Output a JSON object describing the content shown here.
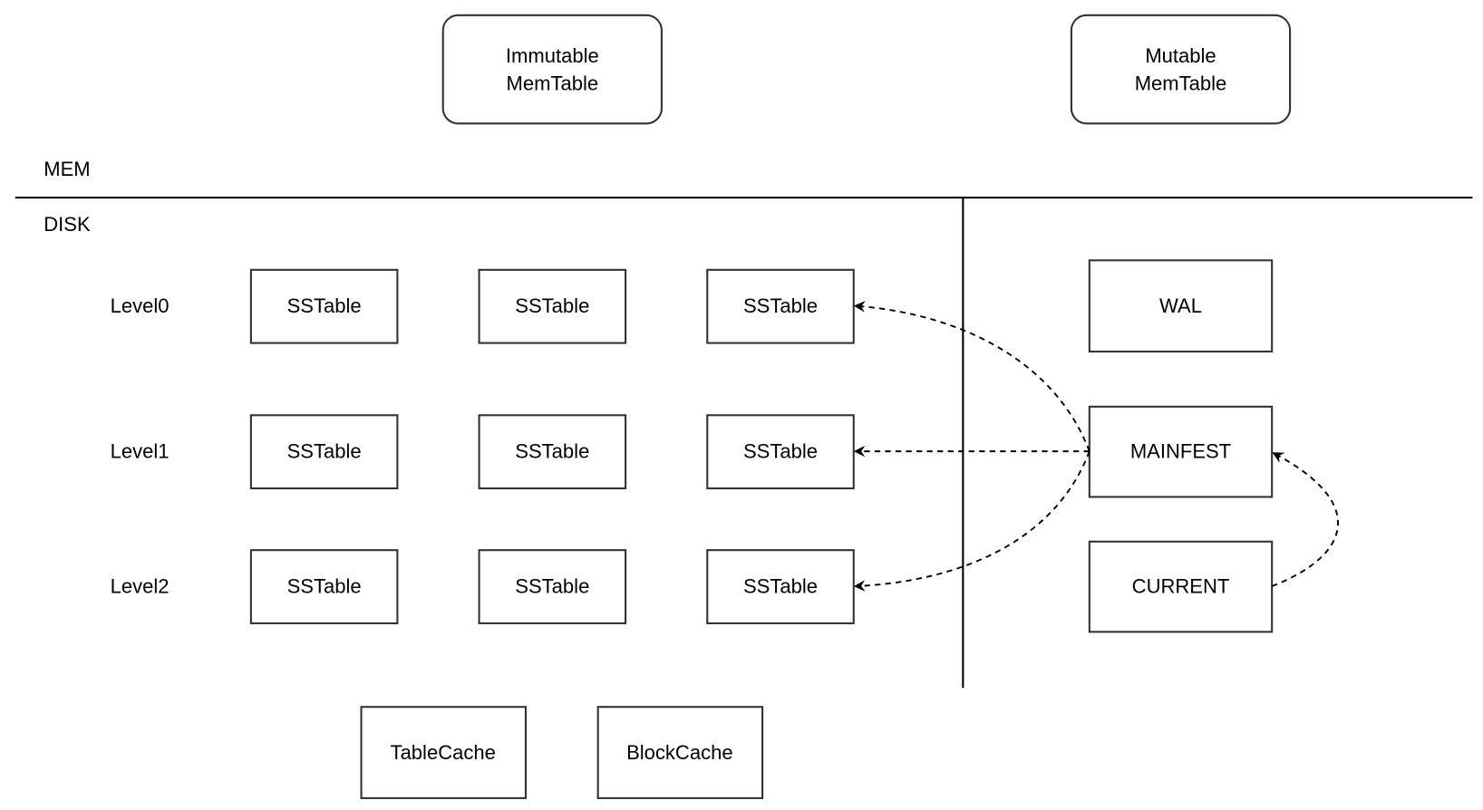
{
  "memory": {
    "label": "MEM",
    "immutable_memtable": [
      "Immutable",
      "MemTable"
    ],
    "mutable_memtable": [
      "Mutable",
      "MemTable"
    ]
  },
  "disk": {
    "label": "DISK",
    "levels": [
      {
        "label": "Level0",
        "tables": [
          "SSTable",
          "SSTable",
          "SSTable"
        ]
      },
      {
        "label": "Level1",
        "tables": [
          "SSTable",
          "SSTable",
          "SSTable"
        ]
      },
      {
        "label": "Level2",
        "tables": [
          "SSTable",
          "SSTable",
          "SSTable"
        ]
      }
    ],
    "files": {
      "wal": "WAL",
      "manifest": "MAINFEST",
      "current": "CURRENT"
    },
    "caches": {
      "table_cache": "TableCache",
      "block_cache": "BlockCache"
    }
  },
  "edges": [
    {
      "from": "MAINFEST",
      "to": "Level0 SSTable",
      "style": "dashed"
    },
    {
      "from": "MAINFEST",
      "to": "Level1 SSTable",
      "style": "dashed"
    },
    {
      "from": "MAINFEST",
      "to": "Level2 SSTable",
      "style": "dashed"
    },
    {
      "from": "CURRENT",
      "to": "MAINFEST",
      "style": "dashed"
    }
  ]
}
